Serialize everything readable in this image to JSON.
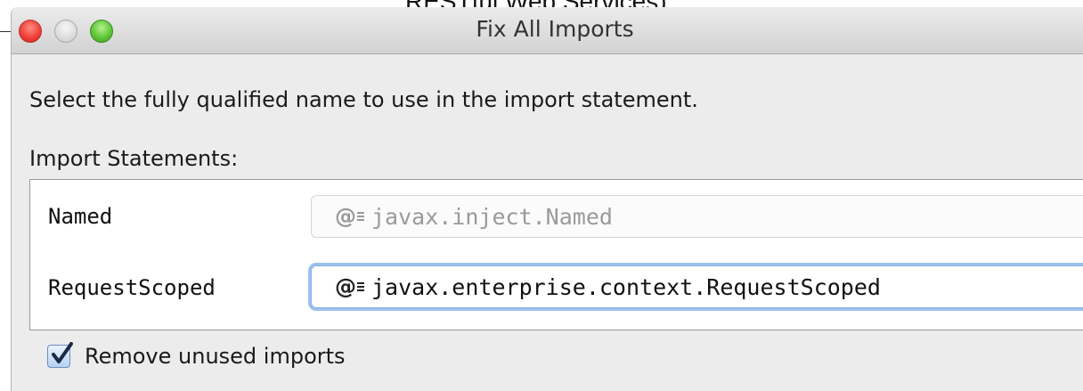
{
  "background": {
    "partial_text": "RESTful Web Services)"
  },
  "window": {
    "title": "Fix All Imports",
    "controls": {
      "close_icon": "close-button-red",
      "minimize_icon": "minimize-button-gray",
      "zoom_icon": "zoom-button-green"
    }
  },
  "instruction": "Select the fully qualified name to use in the import statement.",
  "imports_section": {
    "label": "Import Statements:",
    "rows": [
      {
        "name": "Named",
        "selected_value": "javax.inject.Named",
        "icon": "annotation-icon",
        "enabled": false
      },
      {
        "name": "RequestScoped",
        "selected_value": "javax.enterprise.context.RequestScoped",
        "icon": "annotation-icon",
        "enabled": true,
        "focused": true
      }
    ]
  },
  "remove_unused": {
    "label": "Remove unused imports",
    "checked": true
  },
  "colors": {
    "focus_ring": "#9cc1ee",
    "close": "#f0423a",
    "zoom": "#5fc63a",
    "window_bg": "#ececec"
  }
}
